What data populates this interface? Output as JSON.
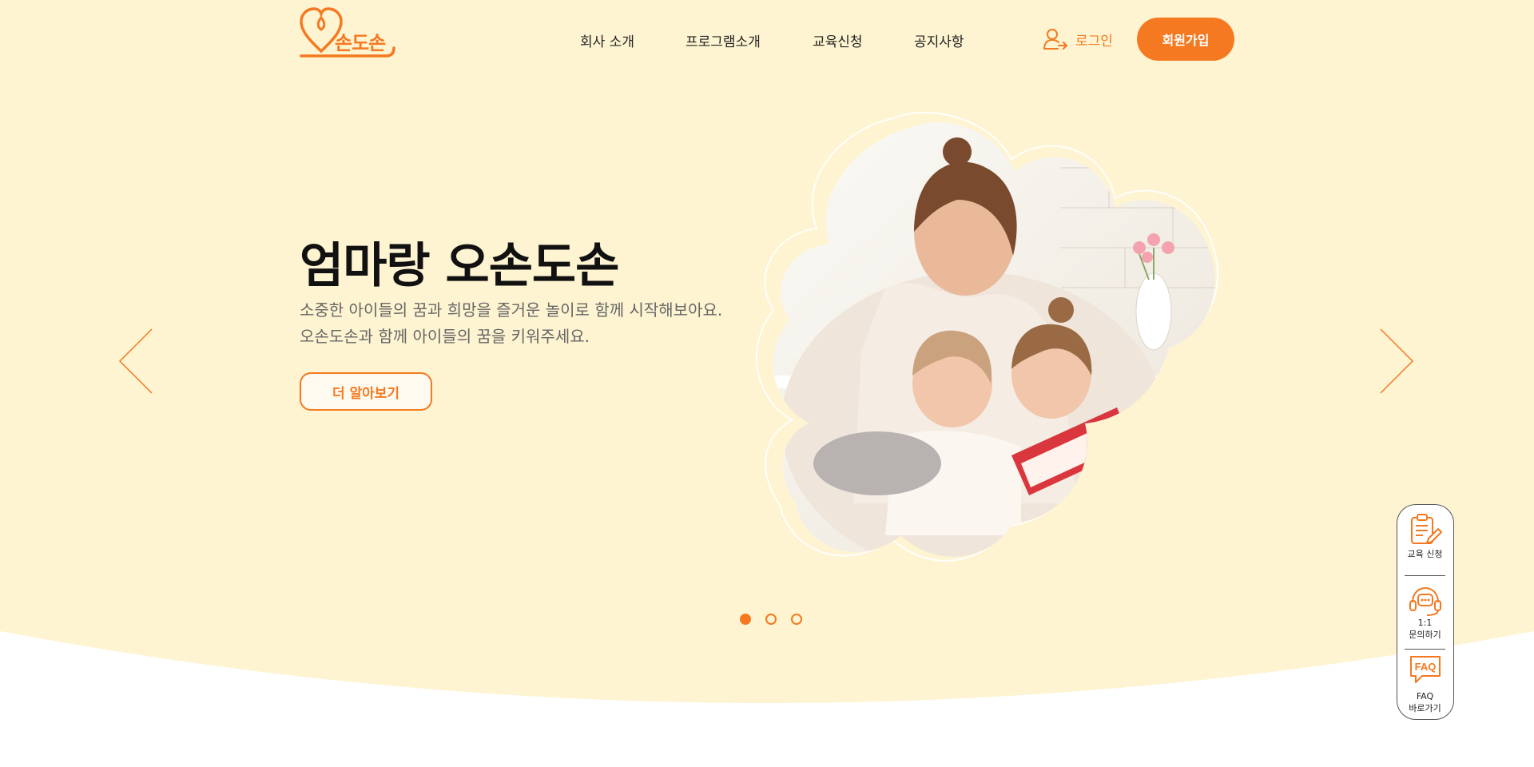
{
  "colors": {
    "accent": "#f47920",
    "hero_bg": "#fef4d1",
    "text": "#222222",
    "muted": "#666666"
  },
  "brand": {
    "logo_text": "손도손"
  },
  "nav": {
    "items": [
      "회사 소개",
      "프로그램소개",
      "교육신청",
      "공지사항"
    ]
  },
  "auth": {
    "login_label": "로그인",
    "login_icon": "user-arrow-icon",
    "signup_label": "회원가입"
  },
  "hero": {
    "title": "엄마랑 오손도손",
    "desc_line1": "소중한 아이들의 꿈과 희망을 즐거운 놀이로 함께 시작해보아요.",
    "desc_line2": "오손도손과 함께 아이들의 꿈을 키워주세요.",
    "button_label": "더 알아보기",
    "image_alt": "mother reading a book with two daughters"
  },
  "slider": {
    "total": 3,
    "active": 1
  },
  "quick_menu": {
    "apply": {
      "icon": "clipboard-pen-icon",
      "label": "교육 신청"
    },
    "inquiry": {
      "icon": "headset-chat-icon",
      "label_line1": "1:1",
      "label_line2": "문의하기"
    },
    "faq": {
      "icon": "faq-bubble-icon",
      "label_line1": "FAQ",
      "label_line2": "바로가기",
      "icon_text": "FAQ"
    }
  }
}
